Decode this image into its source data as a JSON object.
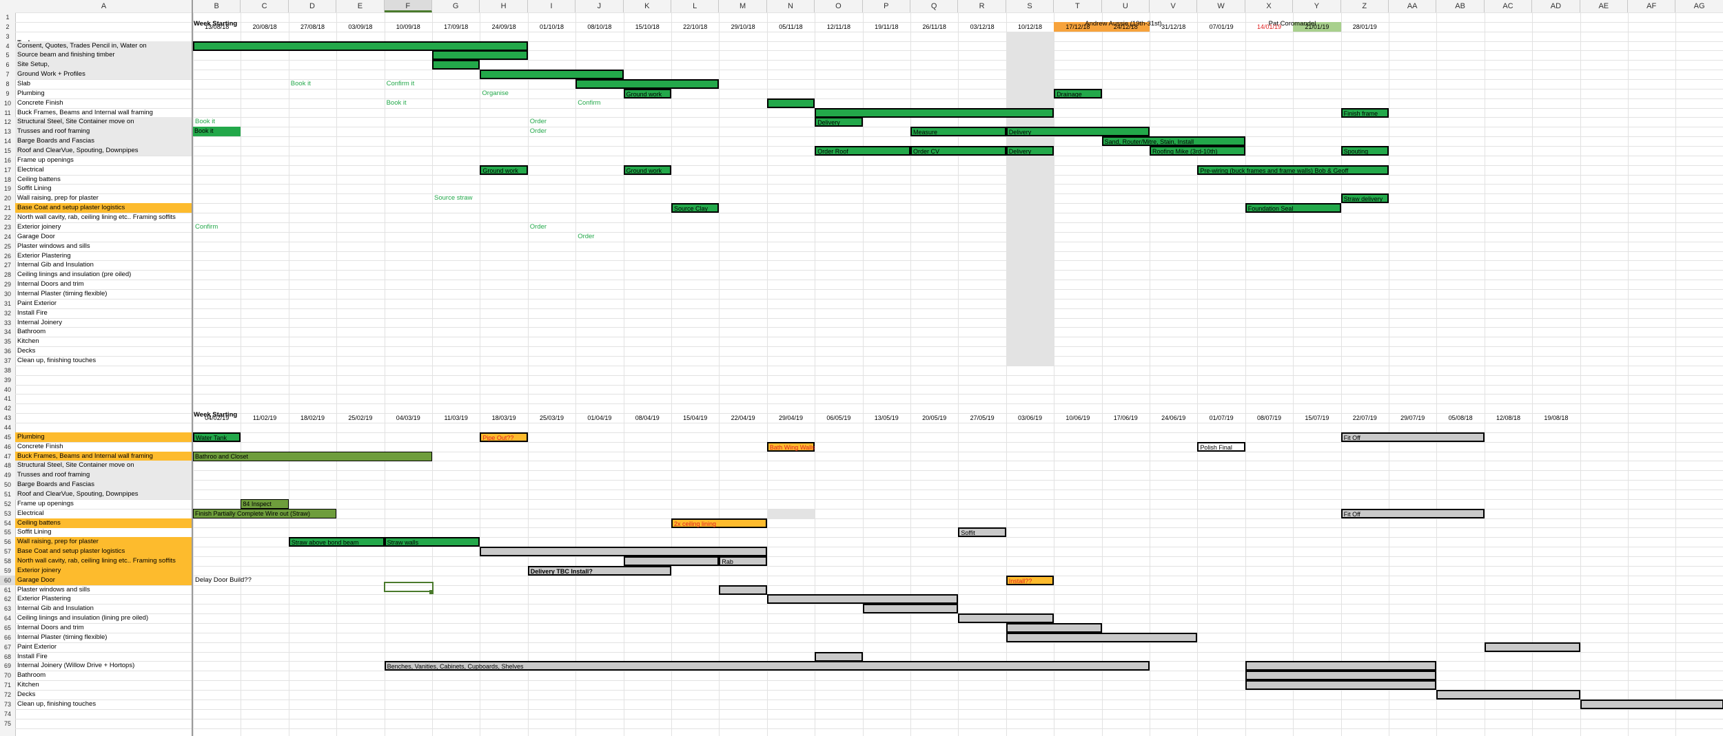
{
  "columns": [
    "A",
    "B",
    "C",
    "D",
    "E",
    "F",
    "G",
    "H",
    "I",
    "J",
    "K",
    "L",
    "M",
    "N",
    "O",
    "P",
    "Q",
    "R",
    "S",
    "T",
    "U",
    "V",
    "W",
    "X",
    "Y",
    "Z",
    "AA",
    "AB",
    "AC",
    "AD",
    "AE",
    "AF",
    "AG"
  ],
  "selected_column": "F",
  "selected_row": "60",
  "headers": {
    "week_starting": "Week Starting",
    "task": "Task",
    "andrew": "Andrew Aussie (19th-31st)",
    "pat": "Pat Coromandel"
  },
  "dates_top": [
    "13/08/18",
    "20/08/18",
    "27/08/18",
    "03/09/18",
    "10/09/18",
    "17/09/18",
    "24/09/18",
    "01/10/18",
    "08/10/18",
    "15/10/18",
    "22/10/18",
    "29/10/18",
    "05/11/18",
    "12/11/18",
    "19/11/18",
    "26/11/18",
    "03/12/18",
    "10/12/18",
    "17/12/18",
    "24/12/18",
    "31/12/18",
    "07/01/19",
    "14/01/19",
    "21/01/19",
    "28/01/19"
  ],
  "dates_bottom": [
    "04/02/19",
    "11/02/19",
    "18/02/19",
    "25/02/19",
    "04/03/19",
    "11/03/19",
    "18/03/19",
    "25/03/19",
    "01/04/19",
    "08/04/19",
    "15/04/19",
    "22/04/19",
    "29/04/19",
    "06/05/19",
    "13/05/19",
    "20/05/19",
    "27/05/19",
    "03/06/19",
    "10/06/19",
    "17/06/19",
    "24/06/19",
    "01/07/19",
    "08/07/19",
    "15/07/19",
    "22/07/19",
    "29/07/19",
    "05/08/18",
    "12/08/18",
    "19/08/18"
  ],
  "tasks_top": [
    {
      "row": 4,
      "label": "Consent, Quotes, Trades Pencil in, Water on",
      "style": "grey"
    },
    {
      "row": 5,
      "label": "Source beam and finishing timber",
      "style": "grey"
    },
    {
      "row": 6,
      "label": "Site Setup,",
      "style": "grey"
    },
    {
      "row": 7,
      "label": "Ground Work + Profiles",
      "style": "grey"
    },
    {
      "row": 8,
      "label": "Slab",
      "style": ""
    },
    {
      "row": 9,
      "label": "Plumbing",
      "style": ""
    },
    {
      "row": 10,
      "label": "Concrete Finish",
      "style": ""
    },
    {
      "row": 11,
      "label": "Buck Frames, Beams and Internal wall framing",
      "style": ""
    },
    {
      "row": 12,
      "label": "Structural Steel, Site Container move on",
      "style": "grey"
    },
    {
      "row": 13,
      "label": "Trusses and roof framing",
      "style": "grey"
    },
    {
      "row": 14,
      "label": "Barge Boards and Fascias",
      "style": "grey"
    },
    {
      "row": 15,
      "label": "Roof and ClearVue, Spouting, Downpipes",
      "style": "grey"
    },
    {
      "row": 16,
      "label": "Frame up openings",
      "style": ""
    },
    {
      "row": 17,
      "label": "Electrical",
      "style": ""
    },
    {
      "row": 18,
      "label": "Ceiling battens",
      "style": ""
    },
    {
      "row": 19,
      "label": "Soffit Lining",
      "style": ""
    },
    {
      "row": 20,
      "label": "Wall raising, prep for plaster",
      "style": ""
    },
    {
      "row": 21,
      "label": "Base Coat and setup plaster logistics",
      "style": "orange"
    },
    {
      "row": 22,
      "label": "North wall cavity, rab, ceiling lining etc.. Framing soffits",
      "style": ""
    },
    {
      "row": 23,
      "label": "Exterior joinery",
      "style": ""
    },
    {
      "row": 24,
      "label": "Garage Door",
      "style": ""
    },
    {
      "row": 25,
      "label": "Plaster windows and sills",
      "style": ""
    },
    {
      "row": 26,
      "label": "Exterior Plastering",
      "style": ""
    },
    {
      "row": 27,
      "label": "Internal Gib and Insulation",
      "style": ""
    },
    {
      "row": 28,
      "label": "Ceiling linings and insulation (pre oiled)",
      "style": ""
    },
    {
      "row": 29,
      "label": "Internal Doors and trim",
      "style": ""
    },
    {
      "row": 30,
      "label": "Internal Plaster (timing flexible)",
      "style": ""
    },
    {
      "row": 31,
      "label": "Paint Exterior",
      "style": ""
    },
    {
      "row": 32,
      "label": "Install Fire",
      "style": ""
    },
    {
      "row": 33,
      "label": "Internal Joinery",
      "style": ""
    },
    {
      "row": 34,
      "label": "Bathroom",
      "style": ""
    },
    {
      "row": 35,
      "label": "Kitchen",
      "style": ""
    },
    {
      "row": 36,
      "label": "Decks",
      "style": ""
    },
    {
      "row": 37,
      "label": "Clean up, finishing touches",
      "style": ""
    }
  ],
  "tasks_bottom": [
    {
      "row": 45,
      "label": "Plumbing",
      "style": "orange"
    },
    {
      "row": 46,
      "label": "Concrete Finish",
      "style": ""
    },
    {
      "row": 47,
      "label": "Buck Frames, Beams and Internal wall framing",
      "style": "orange"
    },
    {
      "row": 48,
      "label": "Structural Steel, Site Container move on",
      "style": "grey"
    },
    {
      "row": 49,
      "label": "Trusses and roof framing",
      "style": "grey"
    },
    {
      "row": 50,
      "label": "Barge Boards and Fascias",
      "style": "grey"
    },
    {
      "row": 51,
      "label": "Roof and ClearVue, Spouting, Downpipes",
      "style": "grey"
    },
    {
      "row": 52,
      "label": "Frame up openings",
      "style": ""
    },
    {
      "row": 53,
      "label": "Electrical",
      "style": ""
    },
    {
      "row": 54,
      "label": "Ceiling battens",
      "style": "orange"
    },
    {
      "row": 55,
      "label": "Soffit Lining",
      "style": ""
    },
    {
      "row": 56,
      "label": "Wall raising, prep for plaster",
      "style": "orange"
    },
    {
      "row": 57,
      "label": "Base Coat and setup plaster logistics",
      "style": "orange"
    },
    {
      "row": 58,
      "label": "North wall cavity, rab, ceiling lining etc.. Framing soffits",
      "style": "orange"
    },
    {
      "row": 59,
      "label": "Exterior joinery",
      "style": "orange"
    },
    {
      "row": 60,
      "label": "Garage Door",
      "style": "orange"
    },
    {
      "row": 61,
      "label": "Plaster windows and sills",
      "style": ""
    },
    {
      "row": 62,
      "label": "Exterior Plastering",
      "style": ""
    },
    {
      "row": 63,
      "label": "Internal Gib and Insulation",
      "style": ""
    },
    {
      "row": 64,
      "label": "Ceiling linings and insulation (lining pre oiled)",
      "style": ""
    },
    {
      "row": 65,
      "label": "Internal Doors and trim",
      "style": ""
    },
    {
      "row": 66,
      "label": "Internal Plaster (timing flexible)",
      "style": ""
    },
    {
      "row": 67,
      "label": "Paint Exterior",
      "style": ""
    },
    {
      "row": 68,
      "label": "Install Fire",
      "style": ""
    },
    {
      "row": 69,
      "label": "Internal Joinery (Willow Drive + Hortops)",
      "style": ""
    },
    {
      "row": 70,
      "label": "Bathroom",
      "style": ""
    },
    {
      "row": 71,
      "label": "Kitchen",
      "style": ""
    },
    {
      "row": 72,
      "label": "Decks",
      "style": ""
    },
    {
      "row": 73,
      "label": "Clean up, finishing touches",
      "style": ""
    }
  ],
  "bars": [
    {
      "row": 4,
      "c0": 0,
      "c1": 7,
      "color": "green",
      "text": ""
    },
    {
      "row": 5,
      "c0": 5,
      "c1": 7,
      "color": "green",
      "text": ""
    },
    {
      "row": 6,
      "c0": 5,
      "c1": 6,
      "color": "green",
      "text": ""
    },
    {
      "row": 7,
      "c0": 6,
      "c1": 9,
      "color": "green",
      "text": ""
    },
    {
      "row": 8,
      "c0": 8,
      "c1": 11,
      "color": "green",
      "text": ""
    },
    {
      "row": 9,
      "c0": 9,
      "c1": 10,
      "color": "green",
      "text": "Ground work"
    },
    {
      "row": 9,
      "c0": 18,
      "c1": 19,
      "color": "green",
      "text": "Drainage"
    },
    {
      "row": 10,
      "c0": 12,
      "c1": 13,
      "color": "green",
      "text": ""
    },
    {
      "row": 11,
      "c0": 13,
      "c1": 18,
      "color": "green",
      "text": ""
    },
    {
      "row": 11,
      "c0": 24,
      "c1": 25,
      "color": "green",
      "text": "Finish frame"
    },
    {
      "row": 12,
      "c0": 13,
      "c1": 14,
      "color": "green",
      "text": "Delivery"
    },
    {
      "row": 13,
      "c0": 15,
      "c1": 17,
      "color": "green",
      "text": "Measure"
    },
    {
      "row": 13,
      "c0": 17,
      "c1": 20,
      "color": "green",
      "text": "Delivery"
    },
    {
      "row": 14,
      "c0": 19,
      "c1": 22,
      "color": "green",
      "text": "Sand, Router/Mitre, Stain, Install"
    },
    {
      "row": 15,
      "c0": 13,
      "c1": 15,
      "color": "green",
      "text": "Order Roof"
    },
    {
      "row": 15,
      "c0": 15,
      "c1": 17,
      "color": "green",
      "text": "Order CV"
    },
    {
      "row": 15,
      "c0": 17,
      "c1": 18,
      "color": "green",
      "text": "Delivery"
    },
    {
      "row": 15,
      "c0": 20,
      "c1": 22,
      "color": "green",
      "text": "Roofing Mike (3rd-10th)"
    },
    {
      "row": 15,
      "c0": 24,
      "c1": 25,
      "color": "green",
      "text": "Spouting"
    },
    {
      "row": 17,
      "c0": 6,
      "c1": 7,
      "color": "green",
      "text": "Ground work"
    },
    {
      "row": 17,
      "c0": 9,
      "c1": 10,
      "color": "green",
      "text": "Ground work"
    },
    {
      "row": 17,
      "c0": 21,
      "c1": 25,
      "color": "green",
      "text": "Pre-wiring (buck frames and frame walls) Bob & Geoff"
    },
    {
      "row": 20,
      "c0": 24,
      "c1": 25,
      "color": "green",
      "text": "Straw delivery"
    },
    {
      "row": 21,
      "c0": 10,
      "c1": 11,
      "color": "green",
      "text": "Source Clay"
    },
    {
      "row": 21,
      "c0": 22,
      "c1": 24,
      "color": "green",
      "text": "Foundation Seal"
    },
    {
      "row": 45,
      "c0": 0,
      "c1": 1,
      "color": "green",
      "text": "Water Tank"
    },
    {
      "row": 45,
      "c0": 6,
      "c1": 7,
      "color": "orange",
      "text": "Pipe Out??",
      "textclass": "red-t"
    },
    {
      "row": 45,
      "c0": 24,
      "c1": 27,
      "color": "grey",
      "text": "Fit Off"
    },
    {
      "row": 46,
      "c0": 12,
      "c1": 13,
      "color": "orange",
      "text": "Bath Wing Walls",
      "textclass": "red-t"
    },
    {
      "row": 46,
      "c0": 21,
      "c1": 22,
      "color": "empty",
      "text": "Polish Final"
    },
    {
      "row": 47,
      "c0": 0,
      "c1": 5,
      "color": "olive",
      "text": "Bathroo  and Closet",
      "thin": true
    },
    {
      "row": 52,
      "c0": 1,
      "c1": 2,
      "color": "olive",
      "text": "84 Inspect",
      "thin": true
    },
    {
      "row": 53,
      "c0": 0,
      "c1": 3,
      "color": "olive",
      "text": "Finish Partially Complete Wire out (Straw)",
      "thin": true
    },
    {
      "row": 53,
      "c0": 24,
      "c1": 27,
      "color": "grey",
      "text": "Fit Off"
    },
    {
      "row": 54,
      "c0": 10,
      "c1": 12,
      "color": "orange",
      "text": "2x ceiling lining",
      "textclass": "red-t"
    },
    {
      "row": 55,
      "c0": 16,
      "c1": 17,
      "color": "grey",
      "text": "Soffit"
    },
    {
      "row": 56,
      "c0": 2,
      "c1": 4,
      "color": "green",
      "text": "Straw above bond beam"
    },
    {
      "row": 56,
      "c0": 4,
      "c1": 6,
      "color": "green",
      "text": "Straw walls"
    },
    {
      "row": 57,
      "c0": 6,
      "c1": 12,
      "color": "grey",
      "text": ""
    },
    {
      "row": 58,
      "c0": 9,
      "c1": 11,
      "color": "grey",
      "text": ""
    },
    {
      "row": 58,
      "c0": 11,
      "c1": 12,
      "color": "grey",
      "text": "Rab"
    },
    {
      "row": 59,
      "c0": 7,
      "c1": 10,
      "color": "grey",
      "text": "Delivery  TBC  Install?",
      "bold": true
    },
    {
      "row": 60,
      "c0": 17,
      "c1": 18,
      "color": "orange",
      "text": "Install??",
      "textclass": "red-t"
    },
    {
      "row": 61,
      "c0": 11,
      "c1": 12,
      "color": "grey",
      "text": ""
    },
    {
      "row": 62,
      "c0": 12,
      "c1": 16,
      "color": "grey",
      "text": ""
    },
    {
      "row": 63,
      "c0": 14,
      "c1": 16,
      "color": "grey",
      "text": ""
    },
    {
      "row": 64,
      "c0": 16,
      "c1": 18,
      "color": "grey",
      "text": ""
    },
    {
      "row": 65,
      "c0": 17,
      "c1": 19,
      "color": "grey",
      "text": ""
    },
    {
      "row": 66,
      "c0": 17,
      "c1": 21,
      "color": "grey",
      "text": ""
    },
    {
      "row": 67,
      "c0": 27,
      "c1": 29,
      "color": "grey",
      "text": ""
    },
    {
      "row": 68,
      "c0": 13,
      "c1": 14,
      "color": "grey",
      "text": ""
    },
    {
      "row": 69,
      "c0": 4,
      "c1": 20,
      "color": "grey",
      "text": "Benches, Vanities, Cabinets, Cupboards, Shelves"
    },
    {
      "row": 69,
      "c0": 22,
      "c1": 26,
      "color": "grey",
      "text": ""
    },
    {
      "row": 70,
      "c0": 22,
      "c1": 26,
      "color": "grey",
      "text": ""
    },
    {
      "row": 71,
      "c0": 22,
      "c1": 26,
      "color": "grey",
      "text": ""
    },
    {
      "row": 72,
      "c0": 26,
      "c1": 29,
      "color": "grey",
      "text": ""
    },
    {
      "row": 73,
      "c0": 29,
      "c1": 32,
      "color": "grey",
      "text": ""
    }
  ],
  "notes": [
    {
      "row": 8,
      "c": 2,
      "text": "Book it",
      "cls": "green-t"
    },
    {
      "row": 8,
      "c": 4,
      "text": "Confirm it",
      "cls": "green-t"
    },
    {
      "row": 9,
      "c": 6,
      "text": "Organise",
      "cls": "green-t"
    },
    {
      "row": 10,
      "c": 4,
      "text": "Book it",
      "cls": "green-t"
    },
    {
      "row": 10,
      "c": 8,
      "text": "Confirm",
      "cls": "green-t"
    },
    {
      "row": 12,
      "c": 0,
      "text": "Book it",
      "cls": "green-t"
    },
    {
      "row": 12,
      "c": 7,
      "text": "Order",
      "cls": "green-t"
    },
    {
      "row": 13,
      "c": 7,
      "text": "Order",
      "cls": "green-t"
    },
    {
      "row": 20,
      "c": 5,
      "text": "Source straw",
      "cls": "green-t"
    },
    {
      "row": 23,
      "c": 0,
      "text": "Confirm",
      "cls": "green-t"
    },
    {
      "row": 23,
      "c": 7,
      "text": "Order",
      "cls": "green-t"
    },
    {
      "row": 24,
      "c": 8,
      "text": "Order",
      "cls": "green-t"
    },
    {
      "row": 60,
      "c": 0,
      "text": "Delay Door Build??",
      "cls": ""
    }
  ],
  "book_it_cell": {
    "row": 13,
    "c": 0,
    "text": "Book it"
  }
}
